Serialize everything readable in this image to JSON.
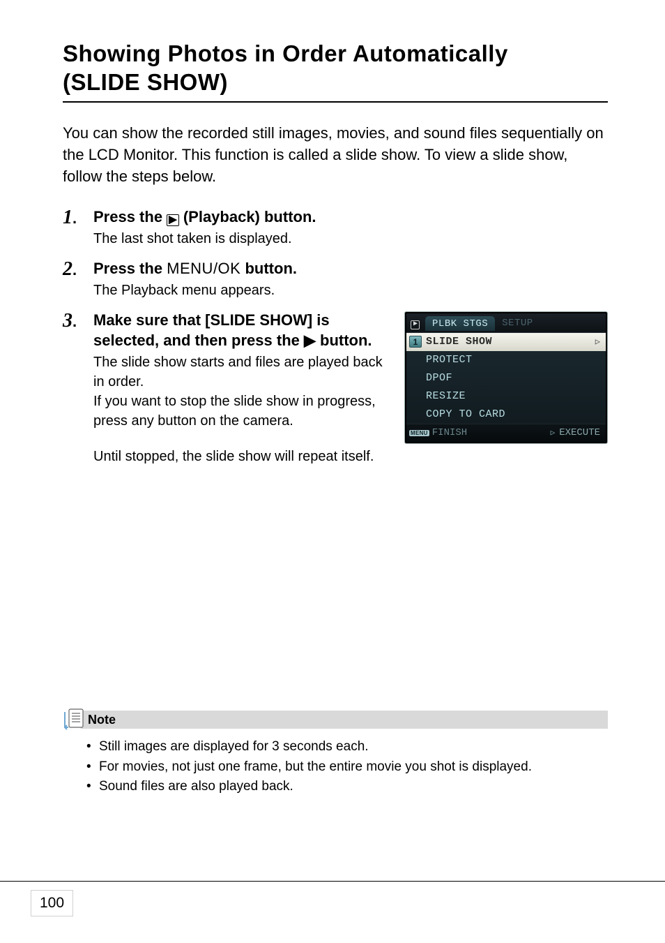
{
  "title_line1": "Showing Photos in Order Automatically",
  "title_line2": "(SLIDE SHOW)",
  "intro": "You can show the recorded still images, movies, and sound files sequentially on the LCD Monitor. This function is called a slide show. To view a slide show, follow the steps below.",
  "steps": {
    "s1": {
      "num": "1",
      "head_pre": "Press the ",
      "head_post": " (Playback) button.",
      "desc": "The last shot taken is displayed."
    },
    "s2": {
      "num": "2",
      "head_pre": "Press the ",
      "menuok": "MENU/OK",
      "head_post": " button.",
      "desc": "The Playback menu appears."
    },
    "s3": {
      "num": "3",
      "head_pre": "Make sure that [SLIDE SHOW] is selected, and then press the ",
      "head_post": " button.",
      "desc": "The slide show starts and files are played back in order.\nIf you want to stop the slide show in progress, press any button on the camera.",
      "desc_tail": "Until stopped, the slide show will repeat itself."
    }
  },
  "lcd": {
    "tab_active": "PLBK STGS",
    "tab_inactive": "SETUP",
    "selected_index": "1",
    "items": [
      "SLIDE SHOW",
      "PROTECT",
      "DPOF",
      "RESIZE",
      "COPY TO CARD"
    ],
    "menu_badge": "MENU",
    "footer_left": "FINISH",
    "footer_right": "EXECUTE"
  },
  "note": {
    "label": "Note",
    "items": [
      "Still images are displayed for 3 seconds each.",
      "For movies, not just one frame, but the entire movie you shot is displayed.",
      "Sound files are also played back."
    ]
  },
  "page_number": "100"
}
